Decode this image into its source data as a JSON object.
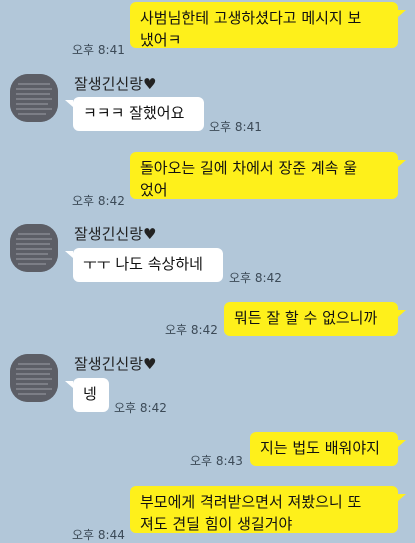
{
  "contact": {
    "name": "잘생긴신랑♥"
  },
  "messages": [
    {
      "dir": "out",
      "text": "사범님한테 고생하셨다고 메시지 보\n냈어ㅋ",
      "time": "오후 8:41"
    },
    {
      "dir": "in",
      "text": "ㅋㅋㅋ 잘했어요",
      "time": "오후 8:41"
    },
    {
      "dir": "out",
      "text": "돌아오는 길에 차에서 장준 계속 울\n었어",
      "time": "오후 8:42"
    },
    {
      "dir": "in",
      "text": "ㅜㅜ 나도 속상하네",
      "time": "오후 8:42"
    },
    {
      "dir": "out",
      "text": "뭐든 잘 할 수 없으니까",
      "time": "오후 8:42"
    },
    {
      "dir": "in",
      "text": "넹",
      "time": "오후 8:42"
    },
    {
      "dir": "out",
      "text": "지는 법도 배워야지",
      "time": "오후 8:43"
    },
    {
      "dir": "out",
      "text": "부모에게 격려받으면서 져봤으니 또\n져도 견딜 힘이 생길거야",
      "time": "오후 8:44"
    }
  ],
  "colors": {
    "background": "#b2c7d9",
    "outgoing": "#fef01b",
    "incoming": "#ffffff"
  },
  "icons": {
    "avatar": "profile-photo-avatar",
    "heart": "heart"
  }
}
